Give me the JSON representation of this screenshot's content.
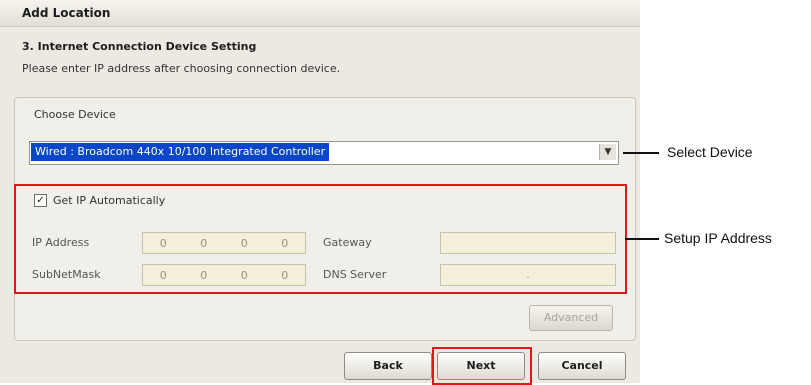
{
  "dialog": {
    "title": "Add Location",
    "step_title": "3. Internet Connection Device Setting",
    "step_description": "Please enter IP address after choosing connection device."
  },
  "device": {
    "label": "Choose Device",
    "selected": "Wired : Broadcom 440x 10/100 Integrated Controller"
  },
  "ip": {
    "auto_label": "Get IP Automatically",
    "auto_checked": true,
    "ip_address_label": "IP Address",
    "ip_address_octets": [
      "0",
      "0",
      "0",
      "0"
    ],
    "subnet_label": "SubNetMask",
    "subnet_octets": [
      "0",
      "0",
      "0",
      "0"
    ],
    "gateway_label": "Gateway",
    "gateway_value": "",
    "dns_label": "DNS Server",
    "dns_value": "."
  },
  "buttons": {
    "advanced": "Advanced",
    "back": "Back",
    "next": "Next",
    "cancel": "Cancel"
  },
  "callouts": {
    "select_device": "Select Device",
    "setup_ip": "Setup IP Address"
  },
  "colors": {
    "highlight": "#e3141a",
    "selection": "#0a46c8"
  }
}
